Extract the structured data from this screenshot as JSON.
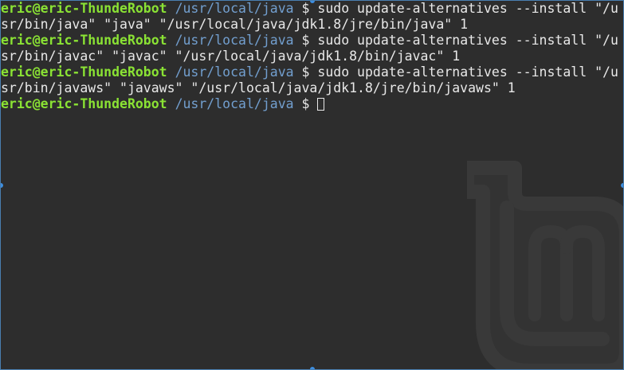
{
  "terminal": {
    "user_host": "eric@eric-ThundeRobot",
    "cwd": "/usr/local/java",
    "prompt_symbol": "$",
    "lines": [
      {
        "type": "prompt",
        "command": "sudo update-alternatives --install \"/u"
      },
      {
        "type": "output",
        "text": "sr/bin/java\" \"java\" \"/usr/local/java/jdk1.8/jre/bin/java\" 1"
      },
      {
        "type": "prompt",
        "command": "sudo update-alternatives --install \"/u"
      },
      {
        "type": "output",
        "text": "sr/bin/javac\" \"javac\" \"/usr/local/java/jdk1.8/bin/javac\" 1"
      },
      {
        "type": "prompt",
        "command": "sudo update-alternatives --install \"/u"
      },
      {
        "type": "output",
        "text": "sr/bin/javaws\" \"javaws\" \"/usr/local/java/jdk1.8/jre/bin/javaws\" 1"
      },
      {
        "type": "prompt",
        "command": ""
      }
    ]
  },
  "colors": {
    "background": "#2d2d2d",
    "user_host": "#8ae234",
    "path": "#729fcf",
    "text": "#e8e8e8",
    "selection_border": "#3d8ee0"
  },
  "icons": {
    "watermark": "linux-mint-logo-icon",
    "cursor": "block-cursor"
  }
}
